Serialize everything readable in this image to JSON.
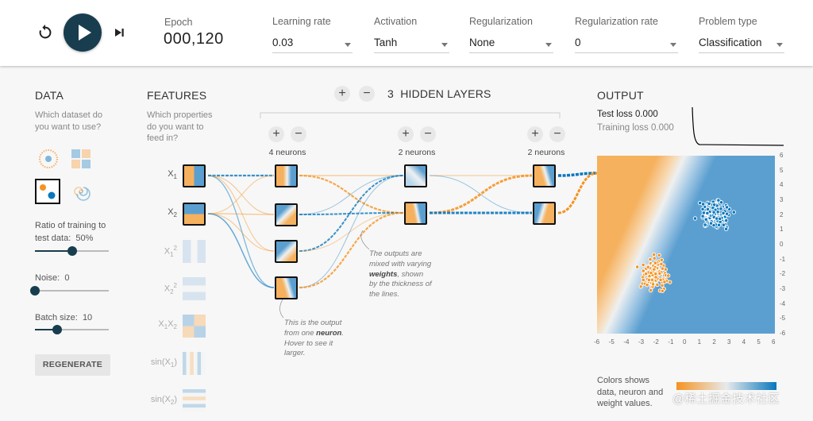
{
  "controls": {
    "reset_icon": "reset-icon",
    "play_icon": "play-icon",
    "step_icon": "step-forward-icon",
    "epoch_label": "Epoch",
    "epoch_value": "000,120",
    "learning_rate": {
      "label": "Learning rate",
      "value": "0.03"
    },
    "activation": {
      "label": "Activation",
      "value": "Tanh"
    },
    "regularization": {
      "label": "Regularization",
      "value": "None"
    },
    "regularization_rate": {
      "label": "Regularization rate",
      "value": "0"
    },
    "problem_type": {
      "label": "Problem type",
      "value": "Classification"
    }
  },
  "data_panel": {
    "title": "DATA",
    "subtitle_line1": "Which dataset do",
    "subtitle_line2": "you want to use?",
    "ratio_label_line1": "Ratio of training to",
    "ratio_label_line2": "test data:",
    "ratio_value": "50%",
    "ratio_fraction": 0.5,
    "noise_label": "Noise:",
    "noise_value": "0",
    "noise_fraction": 0.0,
    "batch_label": "Batch size:",
    "batch_value": "10",
    "batch_fraction": 0.3,
    "regenerate_label": "REGENERATE"
  },
  "features_panel": {
    "title": "FEATURES",
    "subtitle_line1": "Which properties",
    "subtitle_line2": "do you want to",
    "subtitle_line3": "feed in?"
  },
  "hidden": {
    "add_label": "+",
    "remove_label": "−",
    "count": "3",
    "title": "HIDDEN LAYERS",
    "layer1_label": "4 neurons",
    "layer2_label": "2 neurons",
    "layer3_label": "2 neurons"
  },
  "notes": {
    "weights_line1": "The outputs are",
    "weights_line2": "mixed with varying",
    "weights_bold": "weights",
    "weights_line3_rest": ", shown",
    "weights_line4": "by the thickness of",
    "weights_line5": "the lines.",
    "neuron_line1": "This is the output",
    "neuron_line2_pre": "from one ",
    "neuron_bold": "neuron",
    "neuron_line2_post": ".",
    "neuron_line3": "Hover to see it",
    "neuron_line4": "larger."
  },
  "output": {
    "title": "OUTPUT",
    "test_loss_label": "Test loss",
    "test_loss_value": "0.000",
    "training_loss_label": "Training loss",
    "training_loss_value": "0.000",
    "y_ticks": [
      "6",
      "5",
      "4",
      "3",
      "2",
      "1",
      "0",
      "-1",
      "-2",
      "-3",
      "-4",
      "-5",
      "-6"
    ],
    "x_ticks": [
      "-6",
      "-5",
      "-4",
      "-3",
      "-2",
      "-1",
      "0",
      "1",
      "2",
      "3",
      "4",
      "5",
      "6"
    ],
    "legend_line1": "Colors shows",
    "legend_line2": "data, neuron and",
    "legend_line3": "weight values.",
    "legend_min": "-1",
    "legend_max": "1",
    "colors": {
      "positive": "#0877bd",
      "negative": "#f59322",
      "neutral": "#e8eaeb"
    }
  },
  "watermark": "@稀土掘金技术社区"
}
